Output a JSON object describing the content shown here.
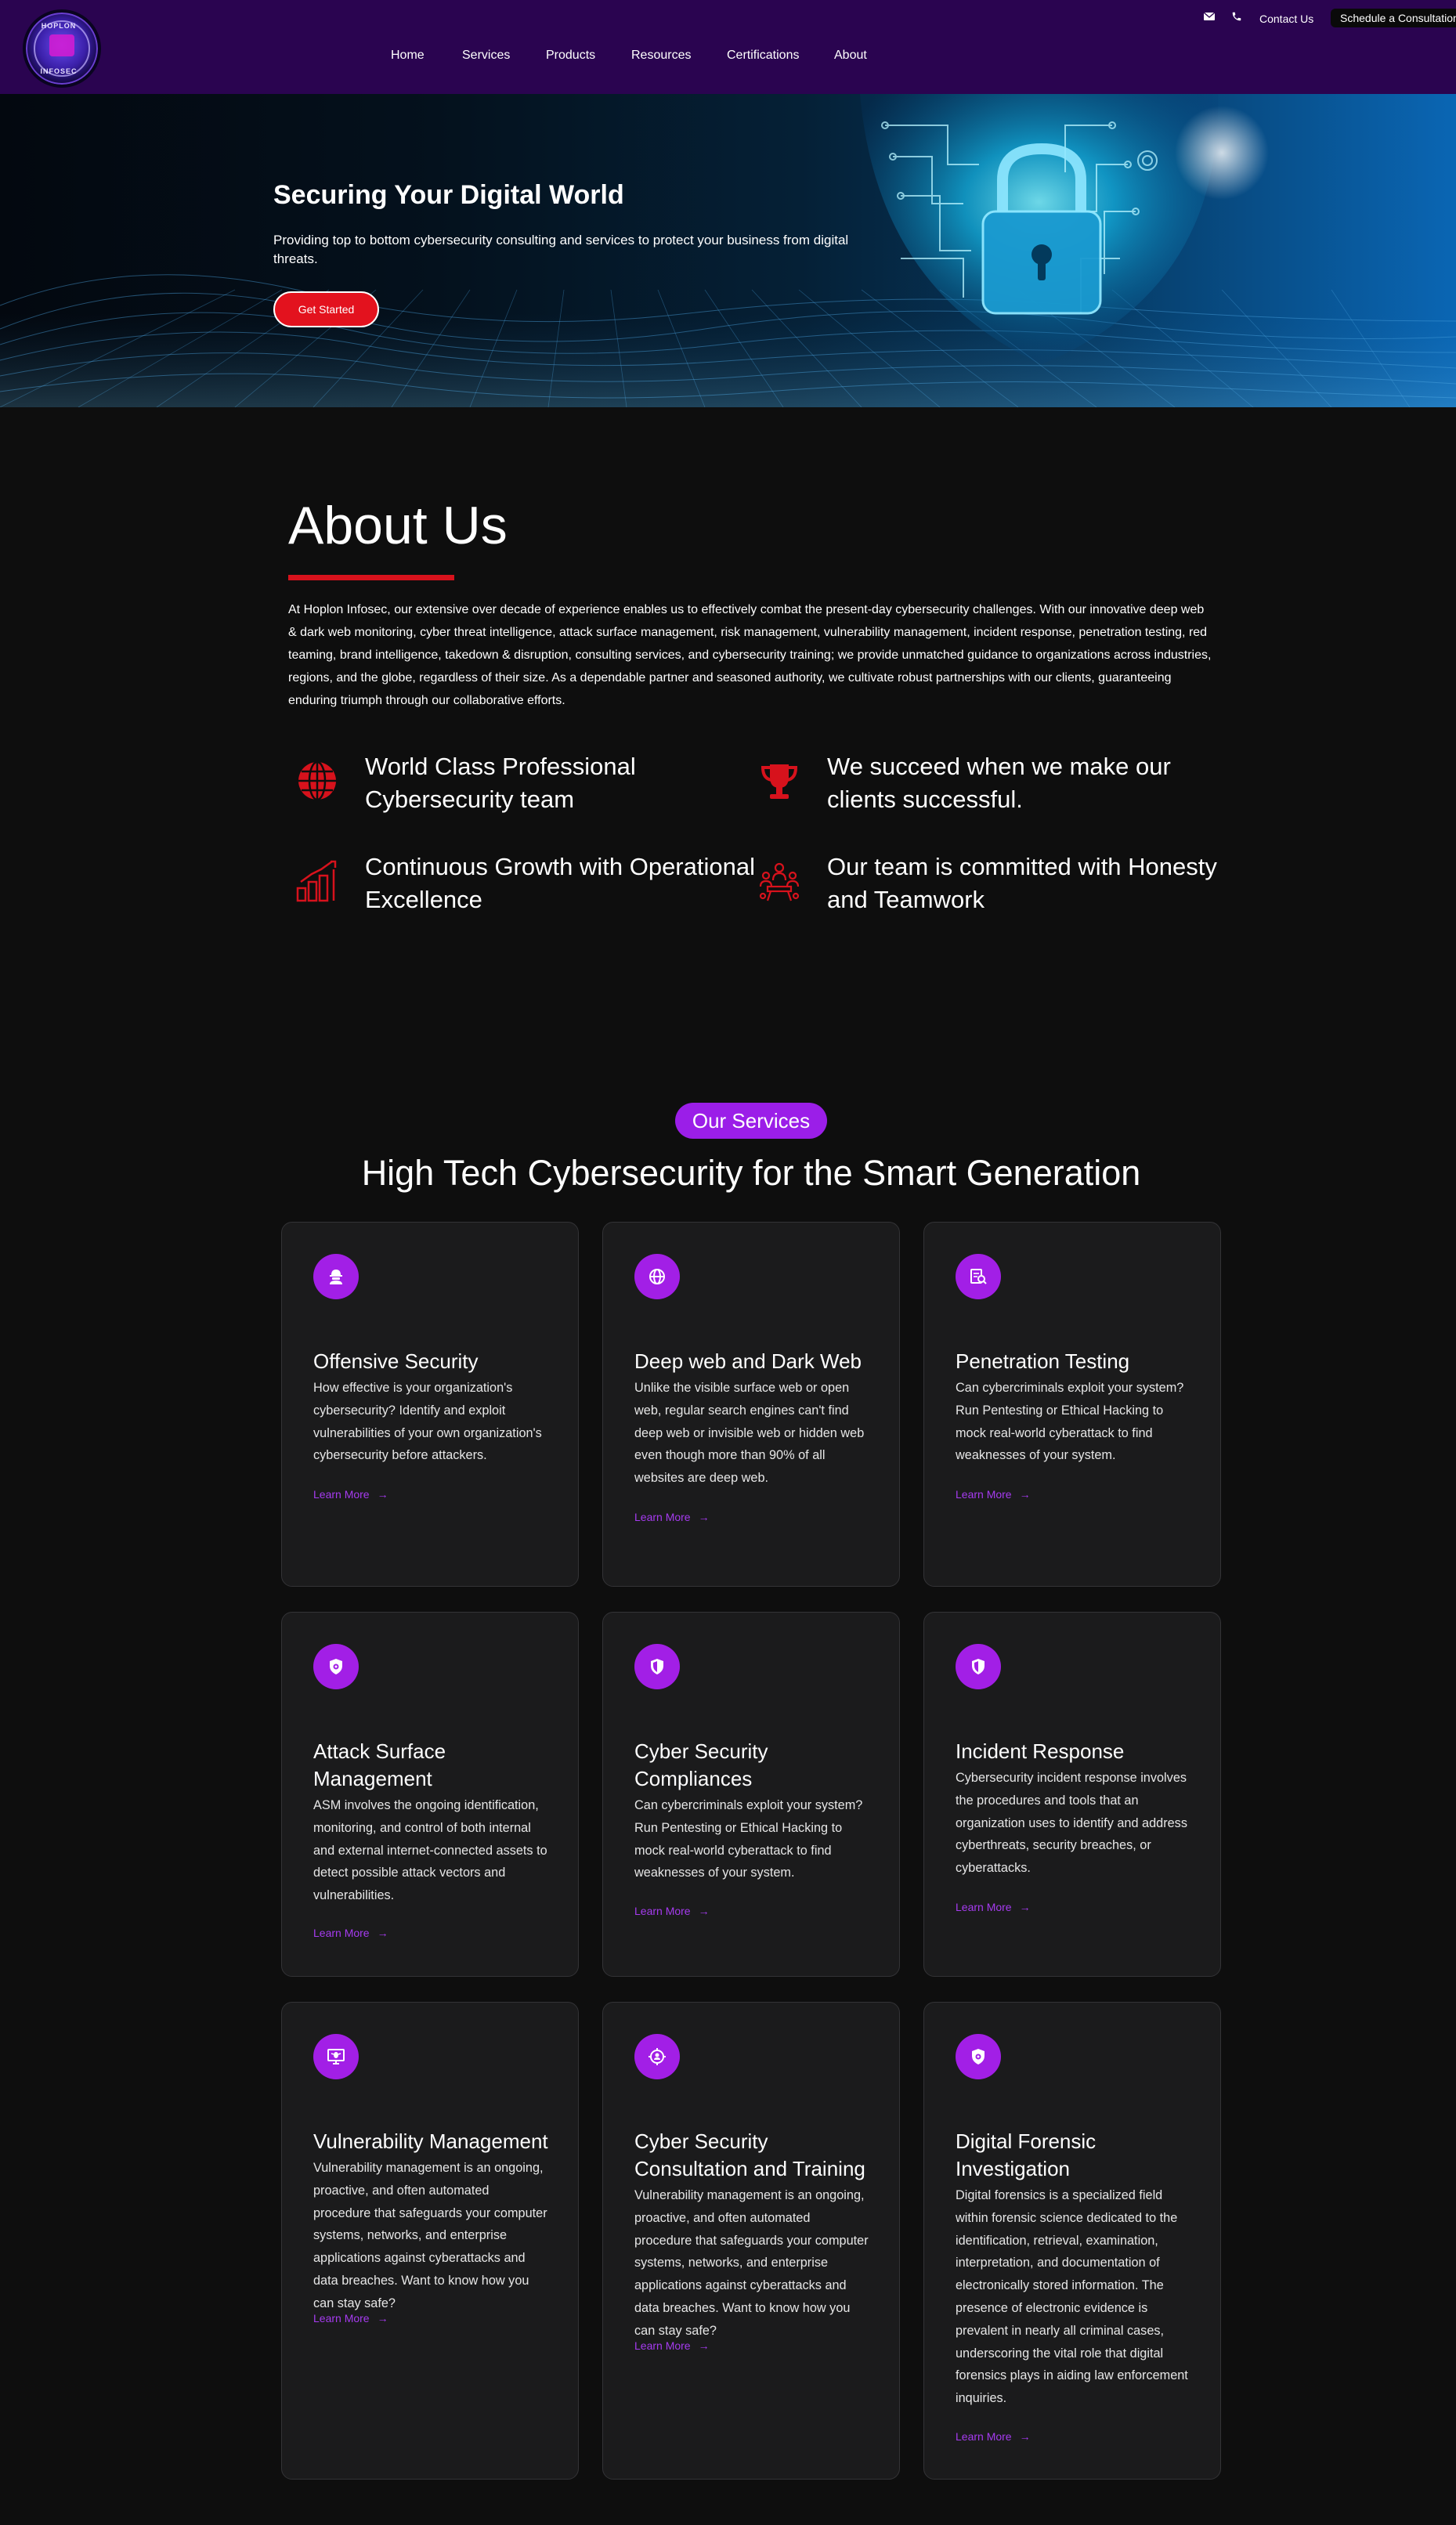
{
  "header": {
    "logo_text_top": "HOPLON",
    "logo_text_bottom": "INFOSEC",
    "nav": [
      "Home",
      "Services",
      "Products",
      "Resources",
      "Certifications",
      "About"
    ],
    "contact_label": "Contact Us",
    "consult_label": "Schedule a Consultation"
  },
  "hero": {
    "title": "Securing Your Digital World",
    "subtitle": "Providing top to bottom cybersecurity consulting and services to protect your business from digital threats.",
    "cta": "Get Started"
  },
  "about": {
    "title": "About Us",
    "text": "At Hoplon Infosec, our extensive over decade of experience enables us to effectively combat the present-day cybersecurity challenges. With our innovative deep web & dark web monitoring, cyber threat intelligence, attack surface management, risk management, vulnerability management, incident response, penetration testing, red teaming, brand intelligence, takedown & disruption, consulting services, and cybersecurity training; we provide unmatched guidance to organizations across industries, regions, and the globe, regardless of their size. As a dependable partner and seasoned authority, we cultivate robust partnerships with our clients, guaranteeing enduring triumph through our collaborative efforts.",
    "features": [
      {
        "text": "World Class Professional Cybersecurity team",
        "icon": "globe-icon"
      },
      {
        "text": "We succeed when we make our clients successful.",
        "icon": "trophy-icon"
      },
      {
        "text": "Continuous Growth with Operational Excellence",
        "icon": "growth-chart-icon"
      },
      {
        "text": "Our team is committed with Honesty and Teamwork",
        "icon": "team-icon"
      }
    ]
  },
  "services": {
    "pill": "Our Services",
    "title": "High Tech Cybersecurity for the Smart Generation",
    "link_label": "Learn More",
    "cards": [
      {
        "title": "Offensive Security",
        "desc": "How effective is your organization's cybersecurity? Identify and exploit vulnerabilities of your own organization's cybersecurity before attackers.",
        "icon": "hacker-icon"
      },
      {
        "title": "Deep web and Dark Web",
        "desc": "Unlike the visible surface web or open web, regular search engines can't find deep web or invisible web or hidden web even though more than 90% of all websites are deep web.",
        "icon": "globe-icon"
      },
      {
        "title": "Penetration Testing",
        "desc": "Can cybercriminals exploit your system? Run Pentesting or Ethical Hacking to mock real-world cyberattack to find weaknesses of your system.",
        "icon": "document-search-icon"
      },
      {
        "title": "Attack Surface Management",
        "desc": "ASM involves the ongoing identification, monitoring, and control of both internal and external internet-connected assets to detect possible attack vectors and vulnerabilities.",
        "icon": "shield-gear-icon"
      },
      {
        "title": "Cyber Security Compliances",
        "desc": "Can cybercriminals exploit your system? Run Pentesting or Ethical Hacking to mock real-world cyberattack to find weaknesses of your system.",
        "icon": "shield-icon"
      },
      {
        "title": "Incident Response",
        "desc": "Cybersecurity incident response involves the procedures and tools that an organization uses to identify and address cyberthreats, security breaches, or cyberattacks.",
        "icon": "shield-icon"
      },
      {
        "title": "Vulnerability Management",
        "desc": "Vulnerability management is an ongoing, proactive, and often automated procedure that safeguards your computer systems, networks, and enterprise applications against cyberattacks and data breaches. Want to know how you can stay safe?",
        "icon": "monitor-bug-icon"
      },
      {
        "title": "Cyber Security Consultation and Training",
        "desc": "Vulnerability management is an ongoing, proactive, and often automated procedure that safeguards your computer systems, networks, and enterprise applications against cyberattacks and data breaches. Want to know how you can stay safe?",
        "icon": "target-person-icon"
      },
      {
        "title": "Digital Forensic Investigation",
        "desc": "Digital forensics is a specialized field within forensic science dedicated to the identification, retrieval, examination, interpretation, and documentation of electronically stored information. The presence of electronic evidence is prevalent in nearly all criminal cases, underscoring the vital role that digital forensics plays in aiding law enforcement inquiries.",
        "icon": "shield-gear-icon"
      }
    ]
  },
  "colors": {
    "header_bg": "#2a0450",
    "accent_red": "#d7121c",
    "accent_purple": "#a21fe6",
    "page_bg": "#0e0e0e",
    "card_bg": "#1b1b1c"
  }
}
